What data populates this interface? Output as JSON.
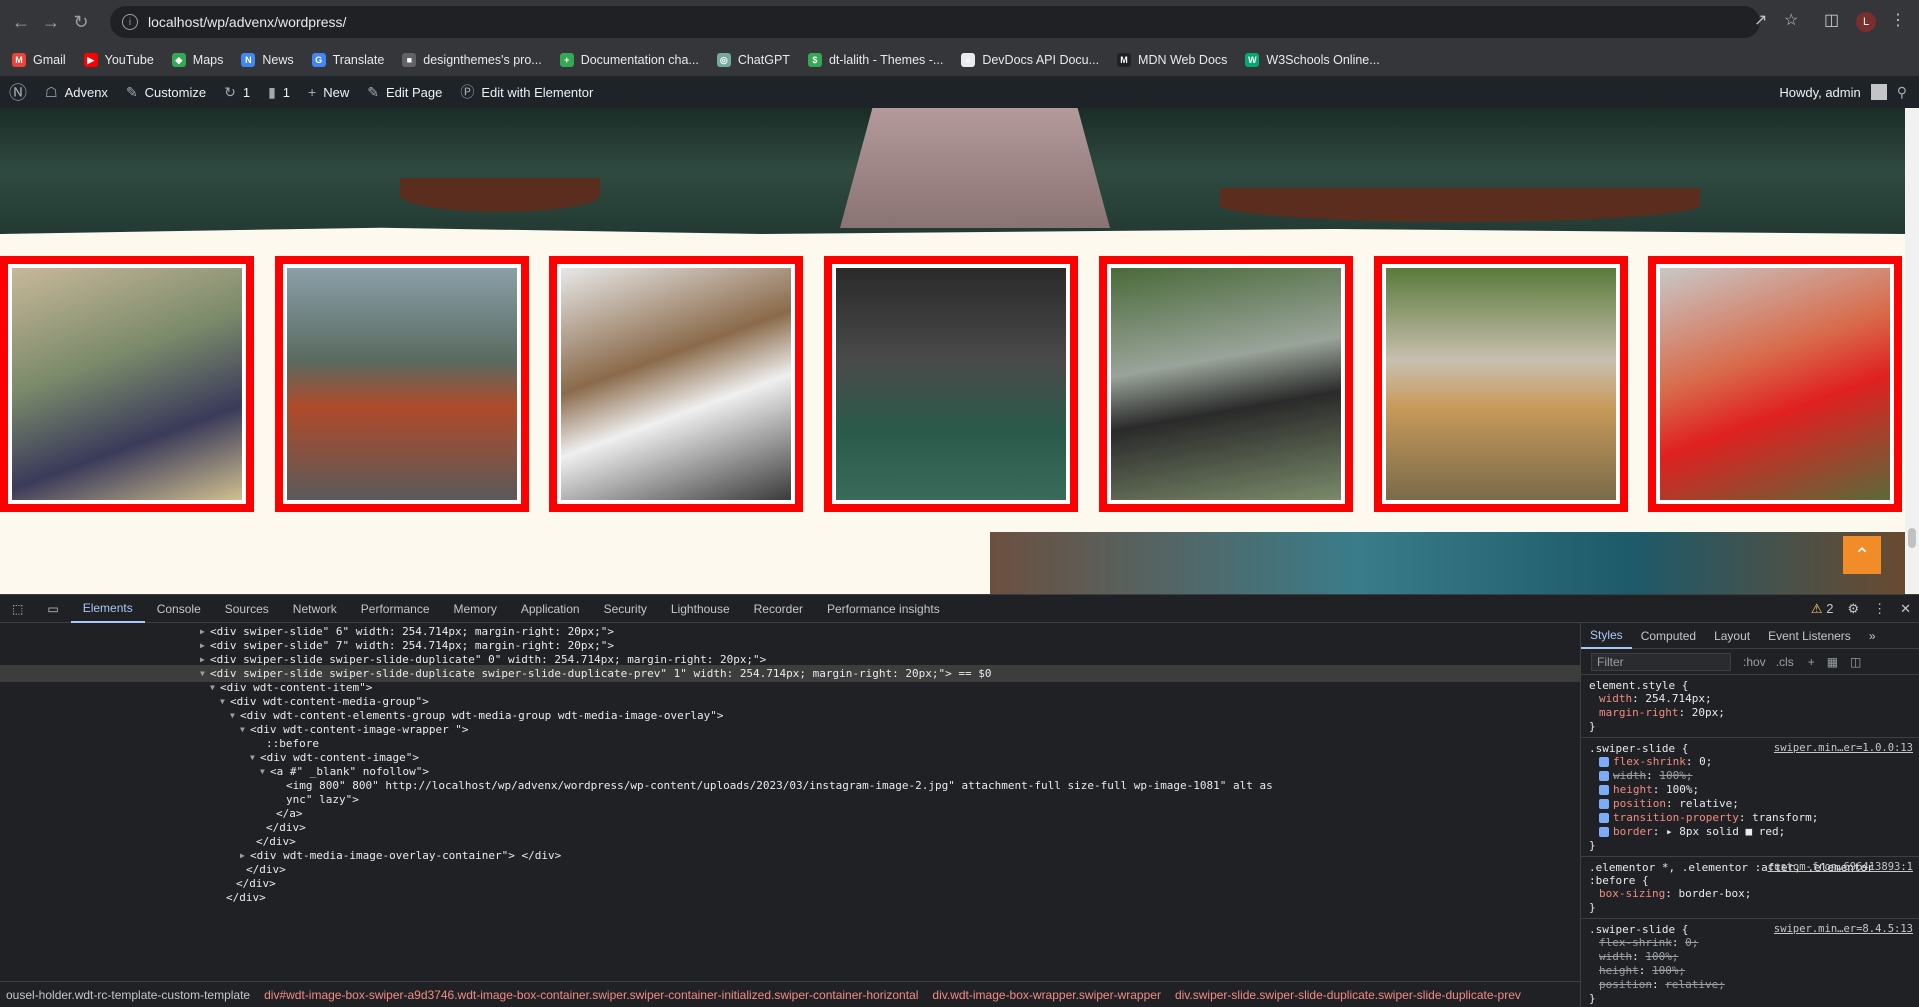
{
  "browser": {
    "url": "localhost/wp/advenx/wordpress/",
    "profile_initial": "L",
    "bookmarks": [
      "Gmail",
      "YouTube",
      "Maps",
      "News",
      "Translate",
      "designthemes's pro...",
      "Documentation cha...",
      "ChatGPT",
      "dt-lalith - Themes -...",
      "DevDocs API Docu...",
      "MDN Web Docs",
      "W3Schools Online..."
    ]
  },
  "wp_admin_bar": {
    "site_name": "Advenx",
    "customize": "Customize",
    "updates_count": "1",
    "comments_count": "1",
    "new": "New",
    "edit_page": "Edit Page",
    "edit_elementor": "Edit with Elementor",
    "howdy": "Howdy, admin"
  },
  "gallery": {
    "slide_border_color": "#ff0000",
    "slide_count": 7
  },
  "devtools": {
    "tabs": [
      "Elements",
      "Console",
      "Sources",
      "Network",
      "Performance",
      "Memory",
      "Application",
      "Security",
      "Lighthouse",
      "Recorder",
      "Performance insights"
    ],
    "active_tab": "Elements",
    "warnings": "2",
    "dom_lines": [
      "<div class=\"swiper-slide\" data-swiper-slide-index=\"6\" style=\"width: 254.714px; margin-right: 20px;\">",
      "<div class=\"swiper-slide\" data-swiper-slide-index=\"7\" style=\"width: 254.714px; margin-right: 20px;\">",
      "<div class=\"swiper-slide swiper-slide-duplicate\" data-swiper-slide-index=\"0\" style=\"width: 254.714px; margin-right: 20px;\">",
      "<div class=\"swiper-slide swiper-slide-duplicate swiper-slide-duplicate-prev\" data-swiper-slide-index=\"1\" style=\"width: 254.714px; margin-right: 20px;\"> == $0",
      "<div class=\"wdt-content-item\">",
      "<div class=\"wdt-content-media-group\">",
      "<div class=\"wdt-content-elements-group wdt-media-group wdt-media-image-overlay\">",
      "<div class=\"wdt-content-image-wrapper \">",
      "::before",
      "<div class=\"wdt-content-image\">",
      "<a href=\"#\" target=\"_blank\" rel=\"nofollow\">",
      "<img width=\"800\" height=\"800\" src=\"http://localhost/wp/advenx/wordpress/wp-content/uploads/2023/03/instagram-image-2.jpg\" class=\"attachment-full size-full wp-image-1081\" alt decoding=\"as",
      "ync\" loading=\"lazy\">",
      "</a>",
      "</div>",
      "</div>",
      "<div class=\"wdt-media-image-overlay-container\"> </div>",
      "</div>",
      "</div>",
      "</div>"
    ],
    "styles_tabs": [
      "Styles",
      "Computed",
      "Layout",
      "Event Listeners"
    ],
    "filter_placeholder": "Filter",
    "hov": ":hov",
    "cls": ".cls",
    "rules": [
      {
        "selector": "element.style {",
        "source": "",
        "props": [
          [
            "width",
            "254.714px;",
            false
          ],
          [
            "margin-right",
            "20px;",
            false
          ]
        ]
      },
      {
        "selector": ".swiper-slide {",
        "source": "swiper.min…er=1.0.0:13",
        "props": [
          [
            "flex-shrink",
            "0;",
            false
          ],
          [
            "width",
            "100%;",
            true
          ],
          [
            "height",
            "100%;",
            false
          ],
          [
            "position",
            "relative;",
            false
          ],
          [
            "transition-property",
            "transform;",
            false
          ],
          [
            "border",
            "▸ 8px solid ■ red;",
            false
          ]
        ]
      },
      {
        "selector": ".elementor *, .elementor :after, .elementor :before {",
        "source": "custom-fron…696413893:1",
        "props": [
          [
            "box-sizing",
            "border-box;",
            false
          ]
        ]
      },
      {
        "selector": ".swiper-slide {",
        "source": "swiper.min…er=8.4.5:13",
        "props": [
          [
            "flex-shrink",
            "0;",
            true
          ],
          [
            "width",
            "100%;",
            true
          ],
          [
            "height",
            "100%;",
            true
          ],
          [
            "position",
            "relative;",
            true
          ]
        ]
      }
    ],
    "breadcrumb": [
      "ousel-holder.wdt-rc-template-custom-template",
      "div#wdt-image-box-swiper-a9d3746.wdt-image-box-container.swiper.swiper-container-initialized.swiper-container-horizontal",
      "div.wdt-image-box-wrapper.swiper-wrapper",
      "div.swiper-slide.swiper-slide-duplicate.swiper-slide-duplicate-prev"
    ]
  }
}
